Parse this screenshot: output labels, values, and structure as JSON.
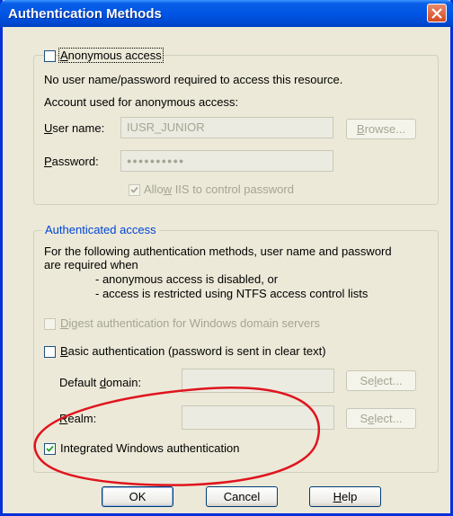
{
  "window": {
    "title": "Authentication Methods"
  },
  "anonymous": {
    "checkbox_label_pre": "",
    "checkbox_label_ul": "A",
    "checkbox_label_post": "nonymous access",
    "checked": false,
    "description": "No user name/password required to access this resource.",
    "account_caption": "Account used for anonymous access:",
    "username_label_ul": "U",
    "username_label_post": "ser name:",
    "username_value": "IUSR_JUNIOR",
    "browse_label_ul": "B",
    "browse_label_post": "rowse...",
    "password_label_ul": "P",
    "password_label_post": "assword:",
    "password_value": "●●●●●●●●●●",
    "allow_iis_pre": "Allo",
    "allow_iis_ul": "w",
    "allow_iis_post": " IIS to control password",
    "allow_iis_checked": true
  },
  "authenticated": {
    "legend": "Authenticated access",
    "desc_line1": "For the following authentication methods, user name and password",
    "desc_line2": "are required when",
    "desc_line3": "- anonymous access is disabled, or",
    "desc_line4": "- access is restricted using NTFS access control lists",
    "digest_ul": "D",
    "digest_post": "igest authentication for Windows domain servers",
    "digest_checked": false,
    "basic_pre": "",
    "basic_ul": "B",
    "basic_post": "asic authentication (password is sent in clear text)",
    "basic_checked": false,
    "domain_pre": "Default ",
    "domain_ul": "d",
    "domain_post": "omain:",
    "domain_value": "",
    "select1_pre": "Se",
    "select1_ul": "l",
    "select1_post": "ect...",
    "realm_ul": "R",
    "realm_post": "ealm:",
    "realm_value": "",
    "select2_pre": "S",
    "select2_ul": "e",
    "select2_post": "lect...",
    "integrated_label": "Integrated Windows authentication",
    "integrated_checked": true
  },
  "buttons": {
    "ok": "OK",
    "cancel": "Cancel",
    "help_ul": "H",
    "help_post": "elp"
  },
  "annotation_color": "#e0141e"
}
